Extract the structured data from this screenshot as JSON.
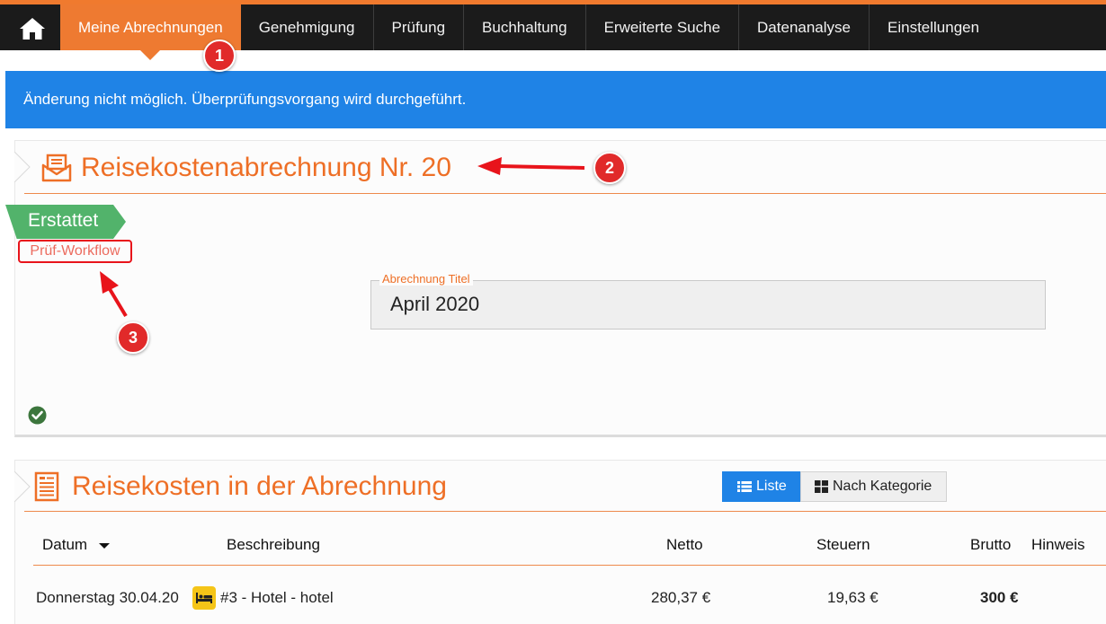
{
  "nav": {
    "home_icon": "home-icon",
    "items": [
      {
        "label": "Meine Abrechnungen",
        "active": true
      },
      {
        "label": "Genehmigung"
      },
      {
        "label": "Prüfung"
      },
      {
        "label": "Buchhaltung"
      },
      {
        "label": "Erweiterte Suche"
      },
      {
        "label": "Datenanalyse"
      },
      {
        "label": "Einstellungen"
      }
    ],
    "accent_color": "#ee7a31"
  },
  "alert": {
    "text": "Änderung nicht möglich. Überprüfungsvorgang wird durchgeführt.",
    "color": "#1f83e6"
  },
  "report": {
    "icon": "envelope-document-icon",
    "title": "Reisekostenabrechnung Nr. 20",
    "status": "Erstattet",
    "status_color": "#52b36b",
    "workflow_link": "Prüf-Workflow",
    "field_label": "Abrechnung Titel",
    "field_value": "April 2020",
    "check_icon": "check-circle-icon"
  },
  "expenses": {
    "icon": "document-list-icon",
    "title": "Reisekosten in der Abrechnung",
    "view_list": "Liste",
    "view_category": "Nach Kategorie",
    "columns": {
      "date": "Datum",
      "description": "Beschreibung",
      "net": "Netto",
      "tax": "Steuern",
      "gross": "Brutto",
      "note": "Hinweis"
    },
    "rows": [
      {
        "date": "Donnerstag 30.04.20",
        "category_icon": "bed-icon",
        "description": "#3 - Hotel - hotel",
        "net": "280,37 €",
        "tax": "19,63 €",
        "gross": "300 €",
        "note": ""
      }
    ]
  },
  "annotations": {
    "badges": [
      "1",
      "2",
      "3"
    ],
    "color": "#e12a2a"
  }
}
